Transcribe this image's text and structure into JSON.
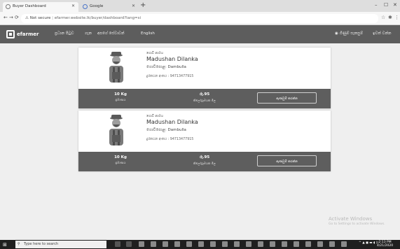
{
  "browser": {
    "tabs": [
      {
        "label": "Buyer Dashboard"
      },
      {
        "label": "Google"
      }
    ],
    "new_tab": "+",
    "url_warning": "Not secure",
    "url": "efarmer.website.lk/buyer/dashboard?lang=si",
    "window_controls": [
      "–",
      "☐",
      "✕"
    ]
  },
  "app": {
    "logo_text": "efarmer",
    "nav": [
      "ප්‍රධාන පිටුව",
      "ගැන",
      "අපගේ සේවාවන්",
      "English"
    ],
    "user_menu": "ගිණුම් සැකසුම්",
    "logout": "ඉවත් වන්න"
  },
  "cards": [
    {
      "label": "ගොවි නාමය",
      "name": "Madushan Dilanka",
      "location": "ගොවිපොළ: Dambulla",
      "phone": "දුරකථන අංකය : 94713477915",
      "quantity": "10 Kg",
      "quantity_label": "ප්‍රමාණය",
      "price": "රු.95",
      "price_label": "කිලෝග්‍රෑමයක මිල",
      "order_button": "ඇණවුම් කරන්න"
    },
    {
      "label": "ගොවි නාමය",
      "name": "Madushan Dilanka",
      "location": "ගොවිපොළ: Dambulla",
      "phone": "දුරකථන අංකය : 94713477915",
      "quantity": "10 Kg",
      "quantity_label": "ප්‍රමාණය",
      "price": "රු.95",
      "price_label": "කිලෝග්‍රෑමයක මිල",
      "order_button": "ඇණවුම් කරන්න"
    }
  ],
  "watermark": {
    "title": "Activate Windows",
    "subtitle": "Go to Settings to activate Windows."
  },
  "taskbar": {
    "search_placeholder": "Type here to search",
    "time": "2:13 PM",
    "date": "4/21/2020",
    "tray": "^ ▲ ◼ ▬ ◖ ))"
  }
}
